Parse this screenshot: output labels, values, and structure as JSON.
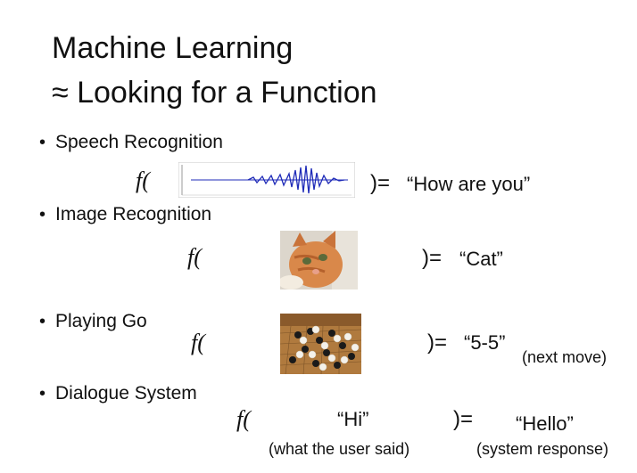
{
  "title": {
    "line1": "Machine Learning",
    "line2": "≈ Looking for a Function"
  },
  "bullet_symbol": "•",
  "function_symbol": "f(",
  "items": [
    {
      "label": "Speech Recognition",
      "close": ")=",
      "output": "“How are you”"
    },
    {
      "label": "Image Recognition",
      "close": ")=",
      "output": "“Cat”"
    },
    {
      "label": "Playing Go",
      "close": ")=",
      "output": "“5-5”",
      "note": "(next move)"
    },
    {
      "label": "Dialogue System",
      "input": "“Hi”",
      "input_note": "(what the user said)",
      "close": ")=",
      "output": "“Hello”",
      "output_note": "(system response)"
    }
  ],
  "images": [
    {
      "name": "waveform-image",
      "color": "#1f2bb8"
    },
    {
      "name": "cat-photo",
      "color": "#d9884a"
    },
    {
      "name": "go-board-photo",
      "color": "#b07a3e"
    }
  ]
}
